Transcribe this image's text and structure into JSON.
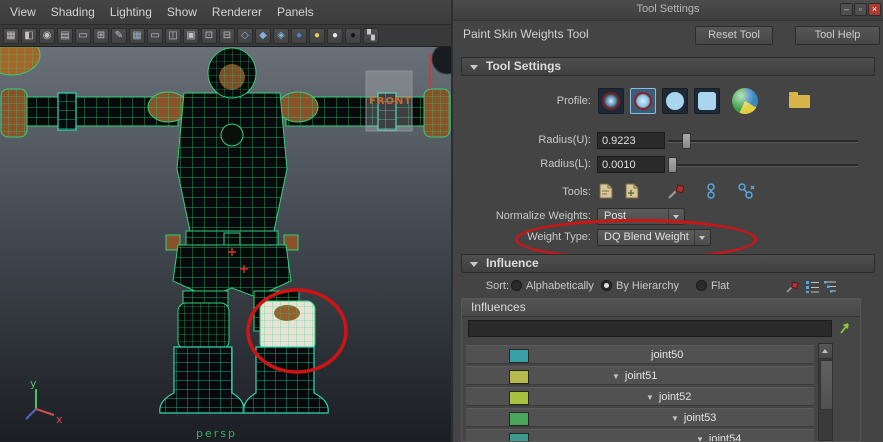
{
  "viewport": {
    "menus": [
      "View",
      "Shading",
      "Lighting",
      "Show",
      "Renderer",
      "Panels"
    ],
    "toolbar_icons": [
      {
        "name": "camera-select-icon",
        "glyph": "▦",
        "color": "#c2c2c2"
      },
      {
        "name": "camera-lock-icon",
        "glyph": "◧",
        "color": "#c2c2c2"
      },
      {
        "name": "camera-attrs-icon",
        "glyph": "◉",
        "color": "#c2c2c2"
      },
      {
        "name": "bookmark-icon",
        "glyph": "▤",
        "color": "#c2c2c2"
      },
      {
        "name": "image-plane-icon",
        "glyph": "▭",
        "color": "#c2c2c2"
      },
      {
        "name": "pan-zoom-icon",
        "glyph": "⊞",
        "color": "#c2c2c2"
      },
      {
        "name": "grease-pencil-icon",
        "glyph": "✎",
        "color": "#c2c2c2"
      },
      {
        "name": "grid-icon",
        "glyph": "▦",
        "color": "#9ab0c4"
      },
      {
        "name": "film-gate-icon",
        "glyph": "▭",
        "color": "#c2c2c2"
      },
      {
        "name": "resolution-gate-icon",
        "glyph": "◫",
        "color": "#c2c2c2"
      },
      {
        "name": "gate-mask-icon",
        "glyph": "▣",
        "color": "#c2c2c2"
      },
      {
        "name": "field-chart-icon",
        "glyph": "⊡",
        "color": "#c2c2c2"
      },
      {
        "name": "safe-action-icon",
        "glyph": "⊟",
        "color": "#c2c2c2"
      },
      {
        "name": "wireframe-cube-icon",
        "glyph": "◇",
        "color": "#7fb2e0"
      },
      {
        "name": "shaded-cube-icon",
        "glyph": "◆",
        "color": "#7fb2e0"
      },
      {
        "name": "textured-cube-icon",
        "glyph": "◈",
        "color": "#7fb2e0"
      },
      {
        "name": "default-material-icon",
        "glyph": "●",
        "color": "#4a86c8"
      },
      {
        "name": "lighting-sphere-icon",
        "glyph": "●",
        "color": "#e2cf45"
      },
      {
        "name": "white-sphere-icon",
        "glyph": "●",
        "color": "#ececec"
      },
      {
        "name": "black-sphere-icon",
        "glyph": "●",
        "color": "#141414"
      },
      {
        "name": "texture-checker-icon",
        "glyph": "▚",
        "color": "#c9c9c9"
      }
    ],
    "overlay": {
      "persp_label": "persp",
      "image_plane_label": "FRONT",
      "axis_y_label": "y",
      "axis_x_label": "x"
    },
    "colors": {
      "wireframe": "#2fd27c",
      "wireframe_alt": "#2fd8b0",
      "annotation": "#d01414"
    }
  },
  "panel": {
    "window_title": "Tool Settings",
    "window_buttons": {
      "minimize": "–",
      "maximize": "▫",
      "close": "×"
    },
    "tool_title": "Paint Skin Weights Tool",
    "reset_button": "Reset Tool",
    "help_button": "Tool Help",
    "tool_settings": {
      "header": "Tool Settings",
      "profile_label": "Profile:",
      "radius_u_label": "Radius(U):",
      "radius_u_value": "0.9223",
      "radius_l_label": "Radius(L):",
      "radius_l_value": "0.0010",
      "tools_label": "Tools:",
      "normalize_label": "Normalize Weights:",
      "normalize_value": "Post",
      "weight_type_label": "Weight Type:",
      "weight_type_value": "DQ Blend Weight"
    },
    "influence": {
      "header": "Influence",
      "sort_label": "Sort:",
      "sort_options": [
        {
          "label": "Alphabetically",
          "selected": false
        },
        {
          "label": "By Hierarchy",
          "selected": true
        },
        {
          "label": "Flat",
          "selected": false
        }
      ],
      "influences_title": "Influences",
      "search_value": "",
      "joints": [
        {
          "name": "joint50",
          "color": "#3a9fa6",
          "expander": ""
        },
        {
          "name": "joint51",
          "color": "#b6b94c",
          "expander": "▼"
        },
        {
          "name": "joint52",
          "color": "#a9c13e",
          "expander": "▼"
        },
        {
          "name": "joint53",
          "color": "#49a75c",
          "expander": "▼"
        },
        {
          "name": "joint54",
          "color": "#3b9b8d",
          "expander": "▼"
        }
      ]
    }
  }
}
